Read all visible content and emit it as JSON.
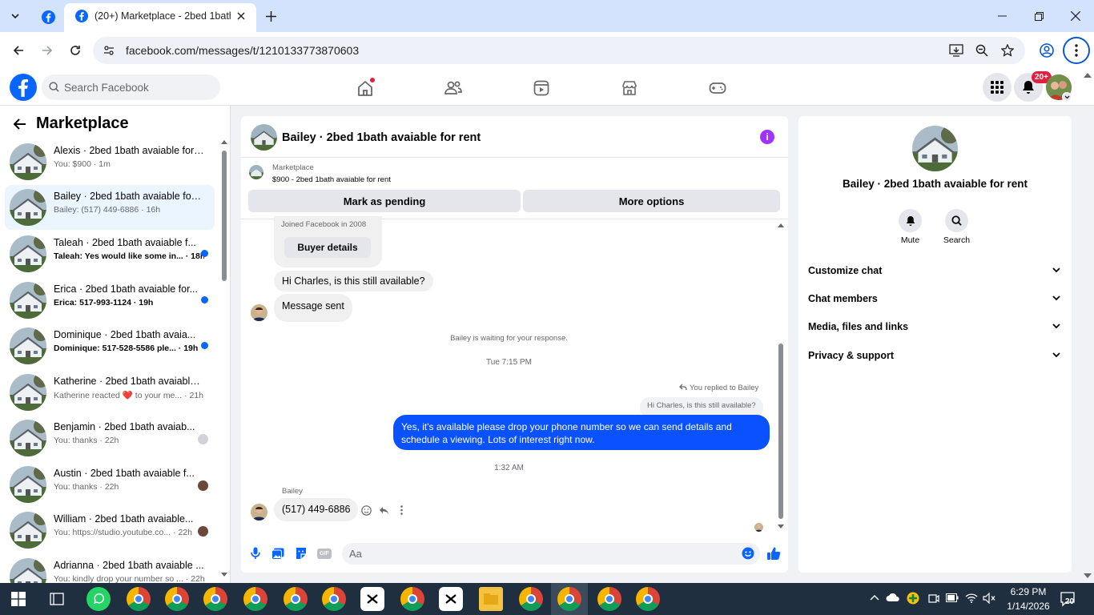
{
  "browser": {
    "tab_title": "(20+) Marketplace - 2bed 1bath",
    "url": "facebook.com/messages/t/1210133773870603"
  },
  "fb": {
    "search_placeholder": "Search Facebook",
    "notif_badge": "20+"
  },
  "left": {
    "title": "Marketplace",
    "conversations": [
      {
        "name": "Alexis · 2bed 1bath avaiable for ...",
        "preview": "You: $900 · 1m",
        "unread": false
      },
      {
        "name": "Bailey · 2bed 1bath avaiable for ...",
        "preview": "Bailey: (517) 449-6886 · 16h",
        "unread": false
      },
      {
        "name": "Taleah · 2bed 1bath avaiable f...",
        "preview": "Taleah: Yes would like some in... · 18h",
        "unread": true
      },
      {
        "name": "Erica · 2bed 1bath avaiable for...",
        "preview": "Erica: 517-993-1124 · 19h",
        "unread": true
      },
      {
        "name": "Dominique · 2bed 1bath avaia...",
        "preview": "Dominique: 517-528-5586 ple... · 19h",
        "unread": true
      },
      {
        "name": "Katherine · 2bed 1bath avaiable ...",
        "preview": "Katherine reacted ❤️ to your me... · 21h",
        "unread": false
      },
      {
        "name": "Benjamin · 2bed 1bath avaiab...",
        "preview": "You: thanks · 22h",
        "unread": false
      },
      {
        "name": "Austin · 2bed 1bath avaiable f...",
        "preview": "You: thanks · 22h",
        "unread": false
      },
      {
        "name": "William · 2bed 1bath avaiable...",
        "preview": "You: https://studio.youtube.co... · 22h",
        "unread": false
      },
      {
        "name": "Adrianna · 2bed 1bath avaiable ...",
        "preview": "You: kindly drop your number so ... · 22h",
        "unread": false
      }
    ]
  },
  "chat": {
    "title": "Bailey · 2bed 1bath avaiable for rent",
    "listing_label": "Marketplace",
    "listing_desc": "$900 - 2bed 1bath avaiable for rent",
    "mark_pending": "Mark as pending",
    "more_options": "More options",
    "joined": "Joined Facebook in 2008",
    "buyer_details": "Buyer details",
    "msg1": "Hi Charles, is this still available?",
    "msg2": "Message sent",
    "waiting": "Bailey is waiting for your response.",
    "time1": "Tue 7:15 PM",
    "replied": "You replied to Bailey",
    "quoted": "Hi Charles, is this still available?",
    "reply": "Yes, it's available please drop your phone number so we can send details and schedule a viewing. Lots of interest right now.",
    "time2": "1:32 AM",
    "sender": "Bailey",
    "msg3": "(517) 449-6886",
    "composer_placeholder": "Aa"
  },
  "right": {
    "name": "Bailey · 2bed 1bath avaiable for rent",
    "mute": "Mute",
    "search": "Search",
    "sections": [
      "Customize chat",
      "Chat members",
      "Media, files and links",
      "Privacy & support"
    ]
  },
  "taskbar": {
    "time": "6:29 PM",
    "date": "1/14/2026",
    "notif_count": "20"
  },
  "colors": {
    "fb_blue": "#0866ff",
    "sent_bubble": "#0a52ff",
    "info_purple": "#a033ff"
  }
}
